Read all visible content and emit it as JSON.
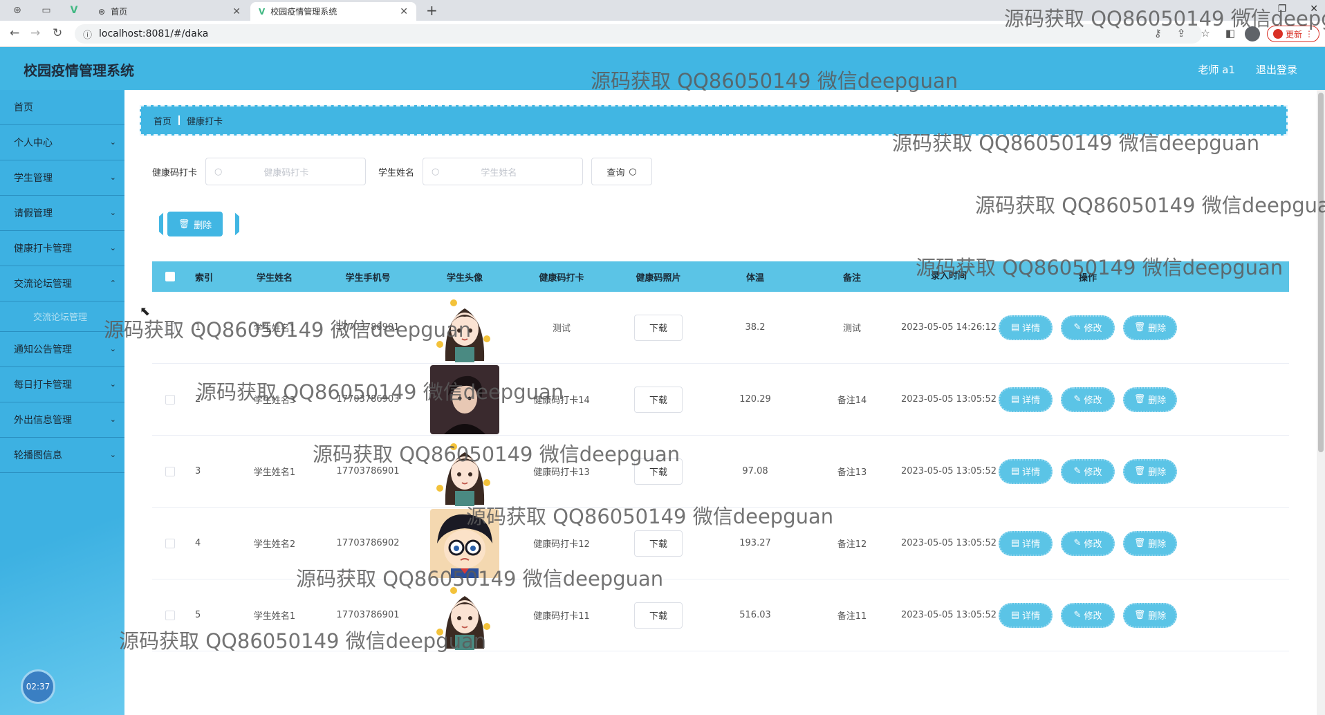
{
  "browser": {
    "tabs": [
      {
        "label": "首页"
      },
      {
        "label": "校园疫情管理系统"
      }
    ],
    "url": "localhost:8081/#/daka",
    "update_label": "更新"
  },
  "app": {
    "title": "校园疫情管理系统",
    "user": "老师 a1",
    "logout": "退出登录"
  },
  "sidebar": {
    "items": [
      {
        "label": "首页"
      },
      {
        "label": "个人中心"
      },
      {
        "label": "学生管理"
      },
      {
        "label": "请假管理"
      },
      {
        "label": "健康打卡管理"
      },
      {
        "label": "交流论坛管理"
      },
      {
        "label": "交流论坛管理"
      },
      {
        "label": "通知公告管理"
      },
      {
        "label": "每日打卡管理"
      },
      {
        "label": "外出信息管理"
      },
      {
        "label": "轮播图信息"
      }
    ],
    "clock": "02:37"
  },
  "breadcrumb": {
    "home": "首页",
    "current": "健康打卡"
  },
  "search": {
    "field1_label": "健康码打卡",
    "field1_placeholder": "健康码打卡",
    "field2_label": "学生姓名",
    "field2_placeholder": "学生姓名",
    "query_label": "查询"
  },
  "bulk_delete_label": "删除",
  "table": {
    "headers": [
      "索引",
      "学生姓名",
      "学生手机号",
      "学生头像",
      "健康码打卡",
      "健康码照片",
      "体温",
      "备注",
      "录入时间",
      "操作"
    ],
    "download_label": "下载",
    "op_labels": {
      "detail": "详情",
      "edit": "修改",
      "delete": "删除"
    },
    "rows": [
      {
        "idx": "1",
        "name": "学生姓名1",
        "phone": "17703786901",
        "health": "测试",
        "temp": "38.2",
        "note": "测试",
        "time": "2023-05-05 14:26:12",
        "avatar": "girl"
      },
      {
        "idx": "2",
        "name": "学生姓名3",
        "phone": "17703786903",
        "health": "健康码打卡14",
        "temp": "120.29",
        "note": "备注14",
        "time": "2023-05-05 13:05:52",
        "avatar": "boy"
      },
      {
        "idx": "3",
        "name": "学生姓名1",
        "phone": "17703786901",
        "health": "健康码打卡13",
        "temp": "97.08",
        "note": "备注13",
        "time": "2023-05-05 13:05:52",
        "avatar": "girl"
      },
      {
        "idx": "4",
        "name": "学生姓名2",
        "phone": "17703786902",
        "health": "健康码打卡12",
        "temp": "193.27",
        "note": "备注12",
        "time": "2023-05-05 13:05:52",
        "avatar": "conan"
      },
      {
        "idx": "5",
        "name": "学生姓名1",
        "phone": "17703786901",
        "health": "健康码打卡11",
        "temp": "516.03",
        "note": "备注11",
        "time": "2023-05-05 13:05:52",
        "avatar": "girl"
      }
    ]
  },
  "watermark": "源码获取 QQ86050149 微信deepguan",
  "colors": {
    "primary": "#41b6e3",
    "header_row": "#5bc4e6"
  }
}
